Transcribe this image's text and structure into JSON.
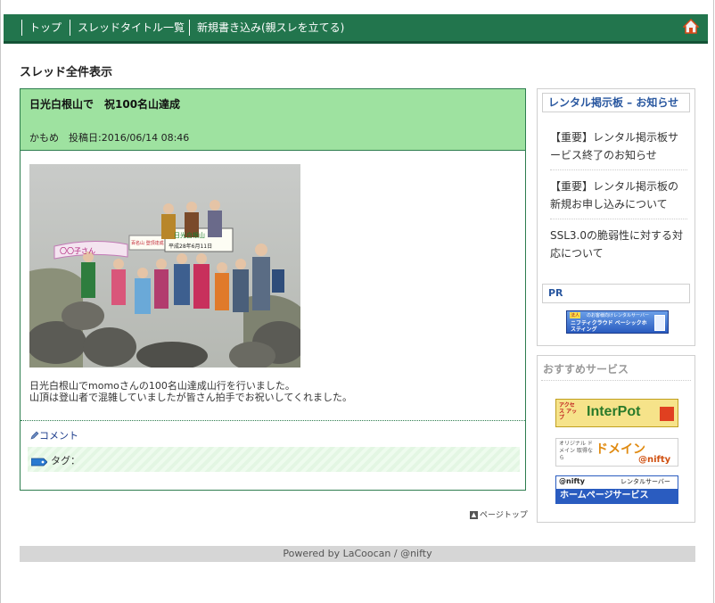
{
  "nav": {
    "items": [
      "トップ",
      "スレッドタイトル一覧",
      "新規書き込み(親スレを立てる)"
    ],
    "home_icon": "home-icon"
  },
  "page": {
    "heading": "スレッド全件表示"
  },
  "post": {
    "title": "日光白根山で　祝100名山達成",
    "meta": "かもめ　投稿日:2016/06/14 08:46",
    "photo_banner_left": "〇〇子さん",
    "photo_banner_mid": "百名山 登頂達成",
    "photo_banner_sign": "日光白根山",
    "photo_banner_date": "平成28年6月11日",
    "body_lines": [
      "日光白根山でmomoさんの100名山達成山行を行いました。",
      "山頂は登山者で混雑していましたが皆さん拍手でお祝いしてくれました。"
    ],
    "comment_label": "コメント",
    "tag_label": "タグ：",
    "header_color": "#9ee2a0",
    "border_color": "#2e7d4f"
  },
  "pagetop": {
    "label": "ページトップ"
  },
  "sidebar": {
    "notice_title": "レンタル掲示板 – お知らせ",
    "notices": [
      "【重要】レンタル掲示板サービス終了のお知らせ",
      "【重要】レンタル掲示板の新規お申し込みについて",
      "SSL3.0の脆弱性に対する対応について"
    ],
    "pr_label": "PR",
    "pr_banner_tag": "法人",
    "pr_banner_sub": "のお客様向けレンタルサーバー",
    "pr_banner_main": "ニフティクラウド ベーシックホスティング",
    "recommend_title": "おすすめサービス",
    "banners": {
      "interpot_small": "アクセス アップ",
      "interpot_main": "InterPot",
      "domain_left": "オリジナル ドメイン 取得なら",
      "domain_main": "ドメイン",
      "domain_sub": "@nifty",
      "hp_top_left": "@nifty",
      "hp_top_right": "レンタルサーバー",
      "hp_main": "ホームページサービス"
    }
  },
  "footer": {
    "text": "Powered by LaCoocan / @nifty"
  },
  "colors": {
    "nav_bg": "#22754d",
    "accent_blue": "#2a58a0"
  }
}
